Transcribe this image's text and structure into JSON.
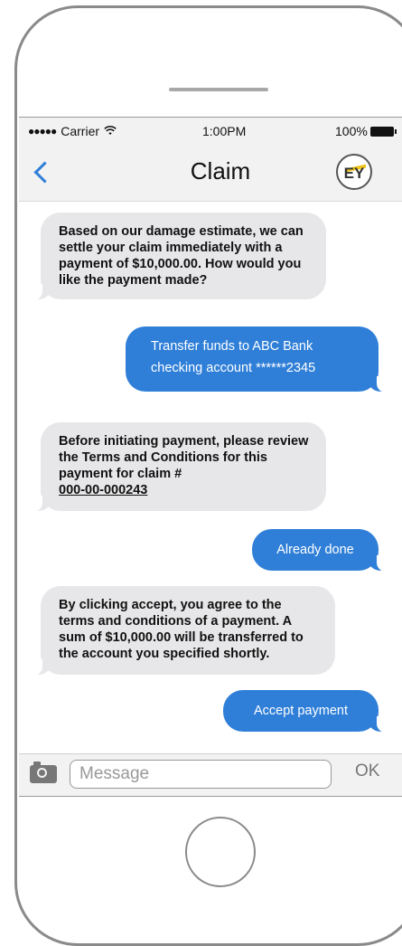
{
  "status_bar": {
    "signal": "●●●●●",
    "carrier": "Carrier",
    "wifi_icon": "wifi-icon",
    "time": "1:00PM",
    "battery_percent": "100%"
  },
  "nav": {
    "title": "Claim",
    "back_icon": "chevron-left-icon",
    "logo_text": "EY"
  },
  "messages": [
    {
      "direction": "incoming",
      "text": "Based on our damage estimate, we can settle your claim immediately with a payment of $10,000.00. How would you like the payment made?"
    },
    {
      "direction": "outgoing",
      "text": "Transfer funds to ABC Bank checking account ******2345"
    },
    {
      "direction": "incoming",
      "text": "Before initiating payment, please review the Terms and Conditions for this payment for claim #",
      "link": "000-00-000243"
    },
    {
      "direction": "outgoing",
      "text": "Already done"
    },
    {
      "direction": "incoming",
      "text": "By clicking accept, you agree to the terms and conditions of a payment. A sum of $10,000.00 will be transferred to the account you specified shortly."
    },
    {
      "direction": "outgoing",
      "text": "Accept payment"
    }
  ],
  "input_bar": {
    "camera_icon": "camera-icon",
    "placeholder": "Message",
    "send_label": "OK"
  },
  "colors": {
    "accent": "#2f7fd8",
    "incoming_bubble": "#e7e7e9",
    "bar_background": "#f2f2f2",
    "logo_bar": "#f0c419"
  }
}
